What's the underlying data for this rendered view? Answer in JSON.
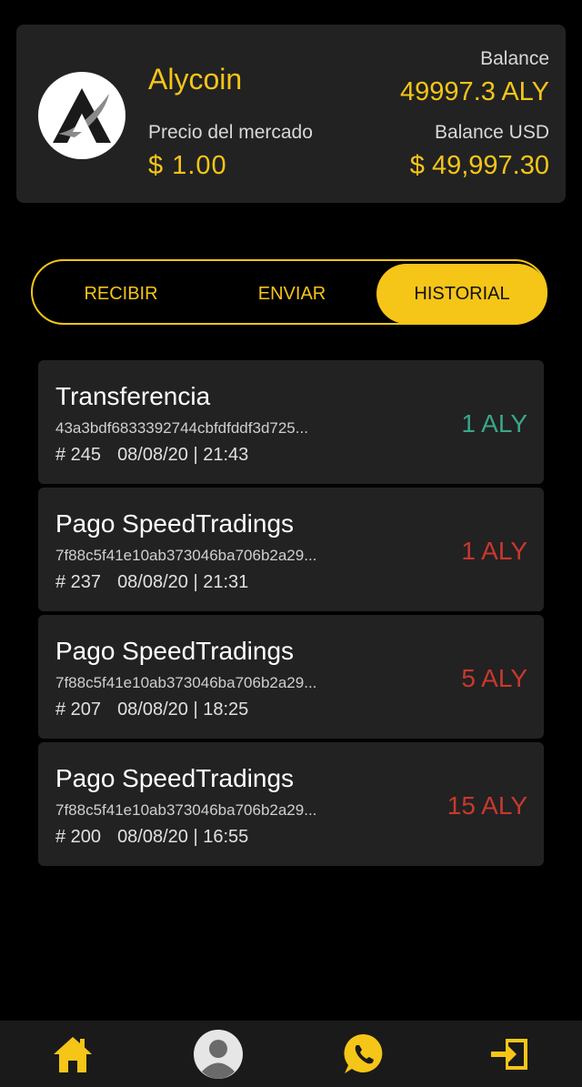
{
  "coin": {
    "name": "Alycoin",
    "market_label": "Precio del mercado",
    "market_price": "$ 1.00",
    "balance_label": "Balance",
    "balance_value": "49997.3 ALY",
    "usd_label": "Balance USD",
    "usd_value": "$ 49,997.30",
    "logo_icon": "alycoin-logo"
  },
  "tabs": [
    {
      "label": "RECIBIR",
      "active": false
    },
    {
      "label": "ENVIAR",
      "active": false
    },
    {
      "label": "HISTORIAL",
      "active": true
    }
  ],
  "transactions": [
    {
      "title": "Transferencia",
      "hash": "43a3bdf6833392744cbfdfddf3d725...",
      "number": "# 245",
      "datetime": "08/08/20 | 21:43",
      "amount": "1 ALY",
      "direction": "incoming"
    },
    {
      "title": "Pago SpeedTradings",
      "hash": "7f88c5f41e10ab373046ba706b2a29...",
      "number": "# 237",
      "datetime": "08/08/20 | 21:31",
      "amount": "1 ALY",
      "direction": "outgoing"
    },
    {
      "title": "Pago SpeedTradings",
      "hash": "7f88c5f41e10ab373046ba706b2a29...",
      "number": "# 207",
      "datetime": "08/08/20 | 18:25",
      "amount": "5 ALY",
      "direction": "outgoing"
    },
    {
      "title": "Pago SpeedTradings",
      "hash": "7f88c5f41e10ab373046ba706b2a29...",
      "number": "# 200",
      "datetime": "08/08/20 | 16:55",
      "amount": "15 ALY",
      "direction": "outgoing"
    }
  ],
  "nav": {
    "items": [
      "home-icon",
      "user-avatar-icon",
      "whatsapp-icon",
      "logout-icon"
    ]
  },
  "colors": {
    "accent": "#f5c518",
    "card": "#222222",
    "background": "#000000",
    "incoming": "#3aa687",
    "outgoing": "#c8382e"
  }
}
